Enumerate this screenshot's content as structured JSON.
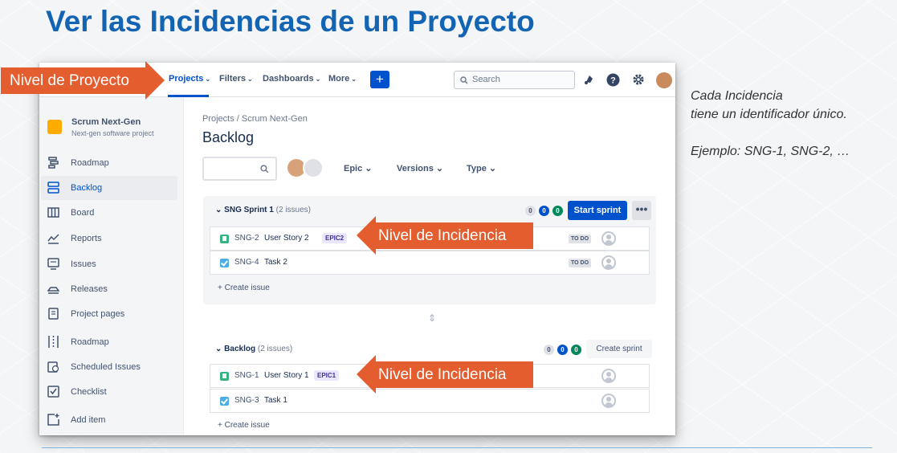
{
  "slide": {
    "title": "Ver las Incidencias de un Proyecto",
    "note_line1": "Cada Incidencia",
    "note_line2": "tiene un identificador único.",
    "note_example": "Ejemplo: SNG-1, SNG-2, …"
  },
  "callouts": {
    "project_level": "Nivel de Proyecto",
    "issue_level": "Nivel de Incidencia"
  },
  "topnav": {
    "projects": "Projects",
    "filters": "Filters",
    "dashboards": "Dashboards",
    "more": "More",
    "create": "+",
    "search_placeholder": "Search"
  },
  "sidebar": {
    "project_name": "Scrum Next-Gen",
    "project_type": "Next-gen software project",
    "items": [
      {
        "label": "Roadmap",
        "icon": "roadmap-icon"
      },
      {
        "label": "Backlog",
        "icon": "backlog-icon"
      },
      {
        "label": "Board",
        "icon": "board-icon"
      },
      {
        "label": "Reports",
        "icon": "reports-icon"
      },
      {
        "label": "Issues",
        "icon": "issues-icon"
      },
      {
        "label": "Releases",
        "icon": "releases-icon"
      },
      {
        "label": "Project pages",
        "icon": "pages-icon"
      },
      {
        "label": "Roadmap",
        "icon": "roadmap2-icon"
      },
      {
        "label": "Scheduled Issues",
        "icon": "scheduled-icon"
      },
      {
        "label": "Checklist",
        "icon": "checklist-icon"
      },
      {
        "label": "Add item",
        "icon": "add-item-icon"
      }
    ]
  },
  "main": {
    "breadcrumb": "Projects  /  Scrum Next-Gen",
    "title": "Backlog",
    "filters": {
      "epic": "Epic",
      "versions": "Versions",
      "type": "Type"
    },
    "sprint": {
      "name": "SNG Sprint 1",
      "count": "(2 issues)",
      "pills": [
        "0",
        "0",
        "0"
      ],
      "start_label": "Start sprint",
      "more_label": "•••",
      "issues": [
        {
          "key": "SNG-2",
          "summary": "User Story 2",
          "epic": "EPIC2",
          "status": "TO DO",
          "type": "story"
        },
        {
          "key": "SNG-4",
          "summary": "Task 2",
          "epic": "",
          "status": "TO DO",
          "type": "task"
        }
      ],
      "create_issue": "+ Create issue"
    },
    "backlog": {
      "name": "Backlog",
      "count": "(2 issues)",
      "pills": [
        "0",
        "0",
        "0"
      ],
      "create_sprint_label": "Create sprint",
      "issues": [
        {
          "key": "SNG-1",
          "summary": "User Story 1",
          "epic": "EPIC1",
          "type": "story"
        },
        {
          "key": "SNG-3",
          "summary": "Task 1",
          "epic": "",
          "type": "task"
        }
      ],
      "create_issue": "+ Create issue"
    }
  },
  "colors": {
    "title_blue": "#1464b4",
    "jira_blue": "#0052cc",
    "callout_orange": "#e35d2f",
    "story_green": "#36b37e",
    "task_blue": "#4bade8"
  }
}
